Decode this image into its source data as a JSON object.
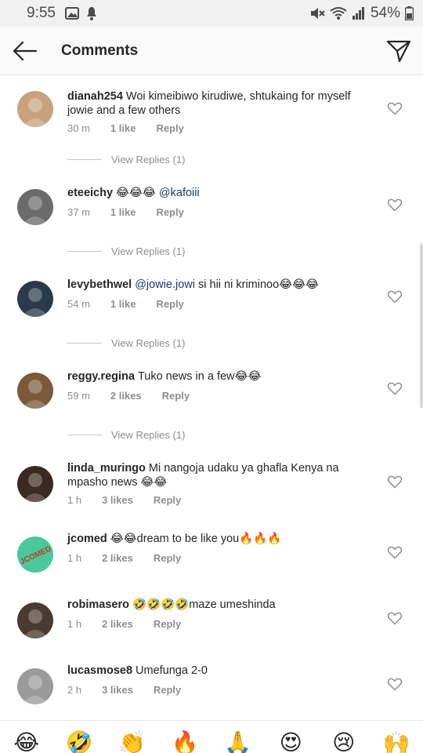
{
  "status_bar": {
    "time": "9:55",
    "battery": "54%"
  },
  "header": {
    "title": "Comments",
    "back_icon": "arrow-left-icon",
    "send_icon": "paper-plane-icon"
  },
  "comments": [
    {
      "username": "dianah254",
      "text": "Woi kimeibiwo kirudiwe, shtukaing for myself jowie and a few others",
      "mention": "",
      "time": "30 m",
      "likes": "1 like",
      "reply": "Reply",
      "view_replies": "View Replies (1)",
      "avatar_color": "#c7a27c"
    },
    {
      "username": "eteeichy",
      "text": "😂😂😂 ",
      "mention": "@kafoiii",
      "time": "37 m",
      "likes": "1 like",
      "reply": "Reply",
      "view_replies": "View Replies (1)",
      "avatar_color": "#6b6b6b"
    },
    {
      "username": "levybethwel",
      "text": "",
      "mention": "@jowie.jowi",
      "text_after": " si hii ni kriminoo😂😂😂",
      "time": "54 m",
      "likes": "1 like",
      "reply": "Reply",
      "view_replies": "View Replies (1)",
      "avatar_color": "#2a3a4a"
    },
    {
      "username": "reggy.regina",
      "text": "Tuko news in a few😂😂",
      "mention": "",
      "time": "59 m",
      "likes": "2 likes",
      "reply": "Reply",
      "view_replies": "View Replies (1)",
      "avatar_color": "#7a5a3a"
    },
    {
      "username": "linda_muringo",
      "text": "Mi nangoja udaku ya ghafla Kenya na mpasho news 😂😂",
      "mention": "",
      "time": "1 h",
      "likes": "3 likes",
      "reply": "Reply",
      "avatar_color": "#3a2a22"
    },
    {
      "username": "jcomed",
      "text": "😂😂dream to be like you🔥🔥🔥",
      "mention": "",
      "time": "1 h",
      "likes": "2 likes",
      "reply": "Reply",
      "avatar_color": "#4cc99a",
      "avatar_text": "JCOMED"
    },
    {
      "username": "robimasero",
      "text": "🤣🤣🤣🤣maze umeshinda",
      "mention": "",
      "time": "1 h",
      "likes": "2 likes",
      "reply": "Reply",
      "avatar_color": "#4a3a30"
    },
    {
      "username": "lucasmose8",
      "text": "Umefunga 2-0",
      "mention": "",
      "time": "2 h",
      "likes": "3 likes",
      "reply": "Reply",
      "avatar_color": "#9a9a9a"
    }
  ],
  "emoji_bar": [
    "😂",
    "🤣",
    "👏",
    "🔥",
    "🙏",
    "😍",
    "😢",
    "🙌"
  ]
}
